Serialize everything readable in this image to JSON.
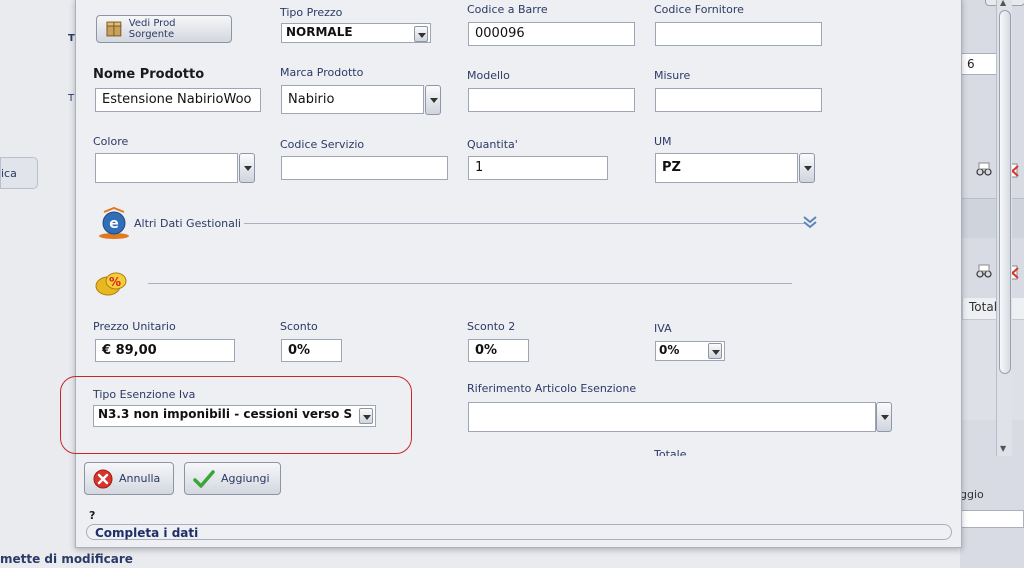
{
  "background": {
    "tab_label": "ica",
    "side_label_t1": "T",
    "side_label_t2": "T",
    "right_field_value": "6",
    "totale_header": "Totale",
    "right_label": "ggio",
    "footer_text": "mette di modificare"
  },
  "dialog": {
    "source_button_label": "Vedi Prod Sorgente",
    "tipo_prezzo": {
      "label": "Tipo Prezzo",
      "value": "NORMALE"
    },
    "codice_barre": {
      "label": "Codice a Barre",
      "value": "000096"
    },
    "codice_fornitore": {
      "label": "Codice Fornitore",
      "value": ""
    },
    "nome_prodotto": {
      "label": "Nome Prodotto",
      "value": "Estensione NabirioWoo"
    },
    "marca_prodotto": {
      "label": "Marca Prodotto",
      "value": "Nabirio"
    },
    "modello": {
      "label": "Modello",
      "value": ""
    },
    "misure": {
      "label": "Misure",
      "value": ""
    },
    "colore": {
      "label": "Colore",
      "value": ""
    },
    "codice_servizio": {
      "label": "Codice Servizio",
      "value": ""
    },
    "quantita": {
      "label": "Quantita'",
      "value": "1"
    },
    "um": {
      "label": "UM",
      "value": "PZ"
    },
    "altri_dati_label": "Altri Dati Gestionali",
    "prezzo_unitario": {
      "label": "Prezzo Unitario",
      "value": "€ 89,00"
    },
    "sconto": {
      "label": "Sconto",
      "value": "0%"
    },
    "sconto2": {
      "label": "Sconto 2",
      "value": "0%"
    },
    "iva": {
      "label": "IVA",
      "value": "0%"
    },
    "tipo_esenzione": {
      "label": "Tipo Esenzione Iva",
      "value": "N3.3 non imponibili - cessioni verso S"
    },
    "riferimento_articolo": {
      "label": "Riferimento Articolo Esenzione",
      "value": ""
    },
    "totale_partial": "Totale",
    "annulla_label": "Annulla",
    "aggiungi_label": "Aggiungi",
    "help_mark": "?",
    "status_text": "Completa i dati"
  },
  "colors": {
    "label_blue": "#2b3a67",
    "highlight_red": "#c8262b",
    "cancel_red": "#d9342b",
    "ok_green": "#3aa63a"
  },
  "icons": [
    "box-icon",
    "info-e-icon",
    "chevron-double-down-icon",
    "percent-coins-icon",
    "cancel-icon",
    "checkmark-icon",
    "glasses-icon",
    "delete-icon"
  ]
}
